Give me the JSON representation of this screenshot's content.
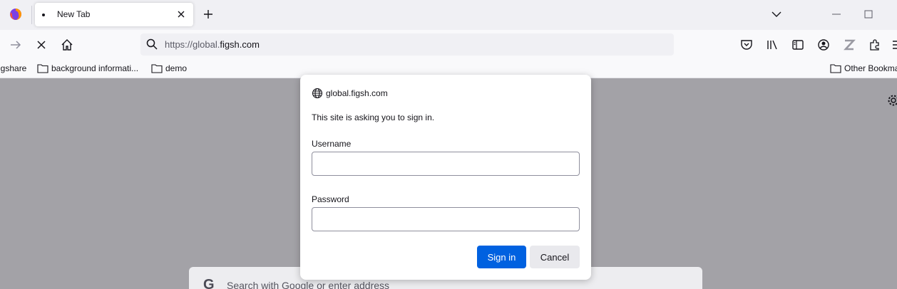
{
  "tabstrip": {
    "tab_title": "New Tab"
  },
  "navbar": {
    "url_prefix": "https://global.",
    "url_domain": "figsh.com"
  },
  "bookmarks": {
    "items": [
      {
        "label": "igshare"
      },
      {
        "label": "background informati..."
      },
      {
        "label": "demo"
      }
    ],
    "other": "Other Bookma"
  },
  "content": {
    "search_placeholder": "Search with Google or enter address",
    "search_engine_icon": "G"
  },
  "dialog": {
    "host": "global.figsh.com",
    "message": "This site is asking you to sign in.",
    "username_label": "Username",
    "username_value": "",
    "password_label": "Password",
    "password_value": "",
    "signin_label": "Sign in",
    "cancel_label": "Cancel"
  },
  "colors": {
    "accent": "#0061e0",
    "overlay": "#a3a2a7"
  }
}
